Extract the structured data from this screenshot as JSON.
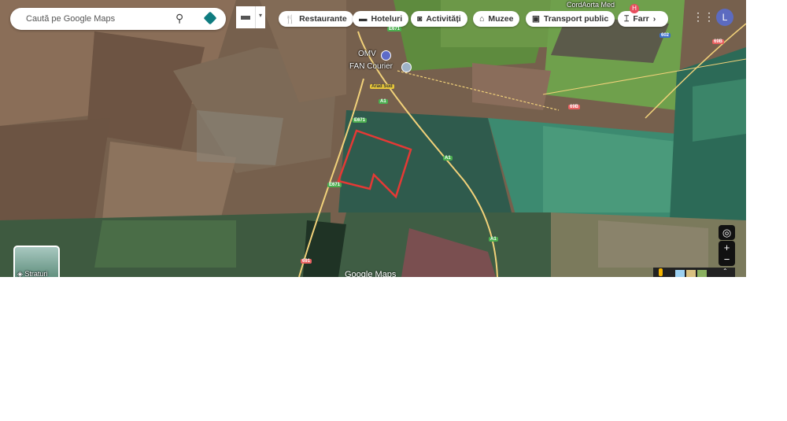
{
  "search": {
    "placeholder": "Caută pe Google Maps",
    "icon": "search-icon",
    "directions_icon": "directions-icon"
  },
  "chips": [
    {
      "label": "Restaurante",
      "icon": "restaurant-icon"
    },
    {
      "label": "Hoteluri",
      "icon": "hotel-icon"
    },
    {
      "label": "Activități",
      "icon": "camera-icon"
    },
    {
      "label": "Muzee",
      "icon": "museum-icon"
    },
    {
      "label": "Transport public",
      "icon": "bus-icon"
    },
    {
      "label": "Farr",
      "icon": "pharmacy-icon"
    }
  ],
  "account": {
    "initial": "L",
    "avatar_color": "#5c6bc0"
  },
  "map": {
    "places": {
      "omv": "OMV",
      "fan": "FAN Courier",
      "arad_sud": "Arad Sud",
      "cordaorta": "CordAorta Med"
    },
    "shields": {
      "e671": "E671",
      "a1": "A1",
      "r602": "602",
      "r69b": "69B",
      "r691": "691"
    },
    "boundary_color": "#e53935",
    "attribution": "Google Maps",
    "layers_label": "Straturi"
  }
}
